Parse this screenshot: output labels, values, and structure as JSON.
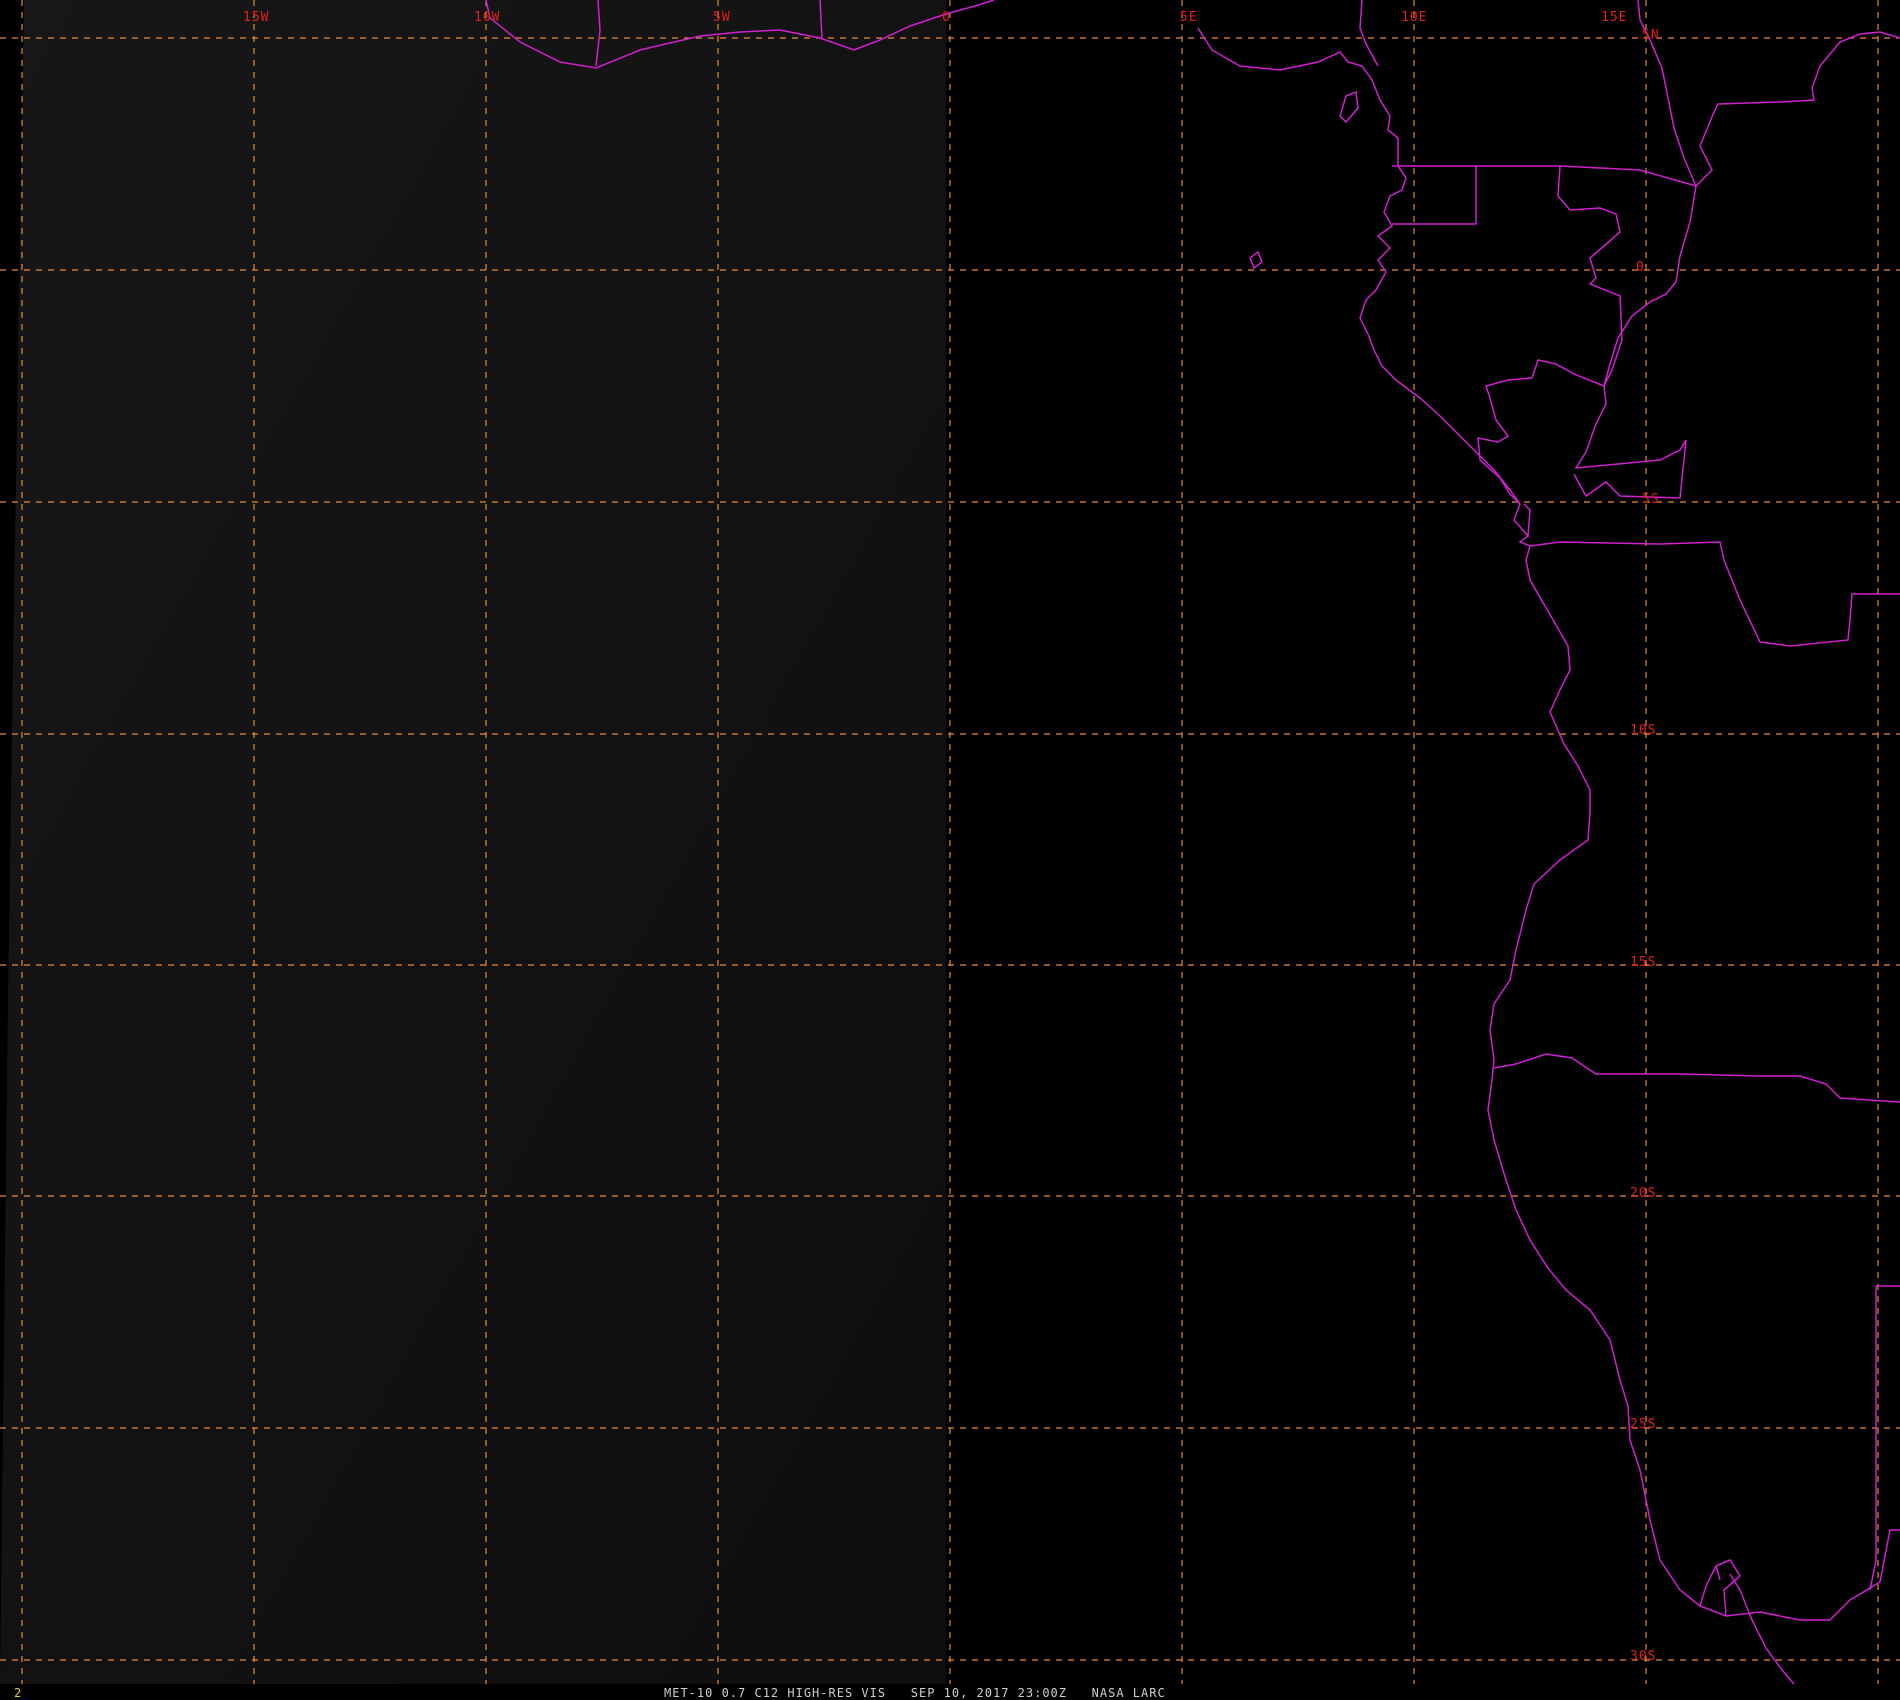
{
  "viewer": {
    "title_caption": "MET-10 0.7 C12 HIGH-RES VIS   SEP 10, 2017 23:00Z   NASA LARC",
    "frame_number": "2"
  },
  "map": {
    "longitude_labels": [
      "15W",
      "10W",
      "5W",
      "0",
      "5E",
      "10E",
      "15E"
    ],
    "latitude_labels": [
      "5N",
      "0",
      "5S",
      "10S",
      "15S",
      "20S",
      "25S",
      "30S"
    ],
    "colors": {
      "background_day": "#121212",
      "background_night": "#000000",
      "graticule": "#e88a3a",
      "coastline": "#d020d0",
      "label": "#e0201a"
    }
  }
}
